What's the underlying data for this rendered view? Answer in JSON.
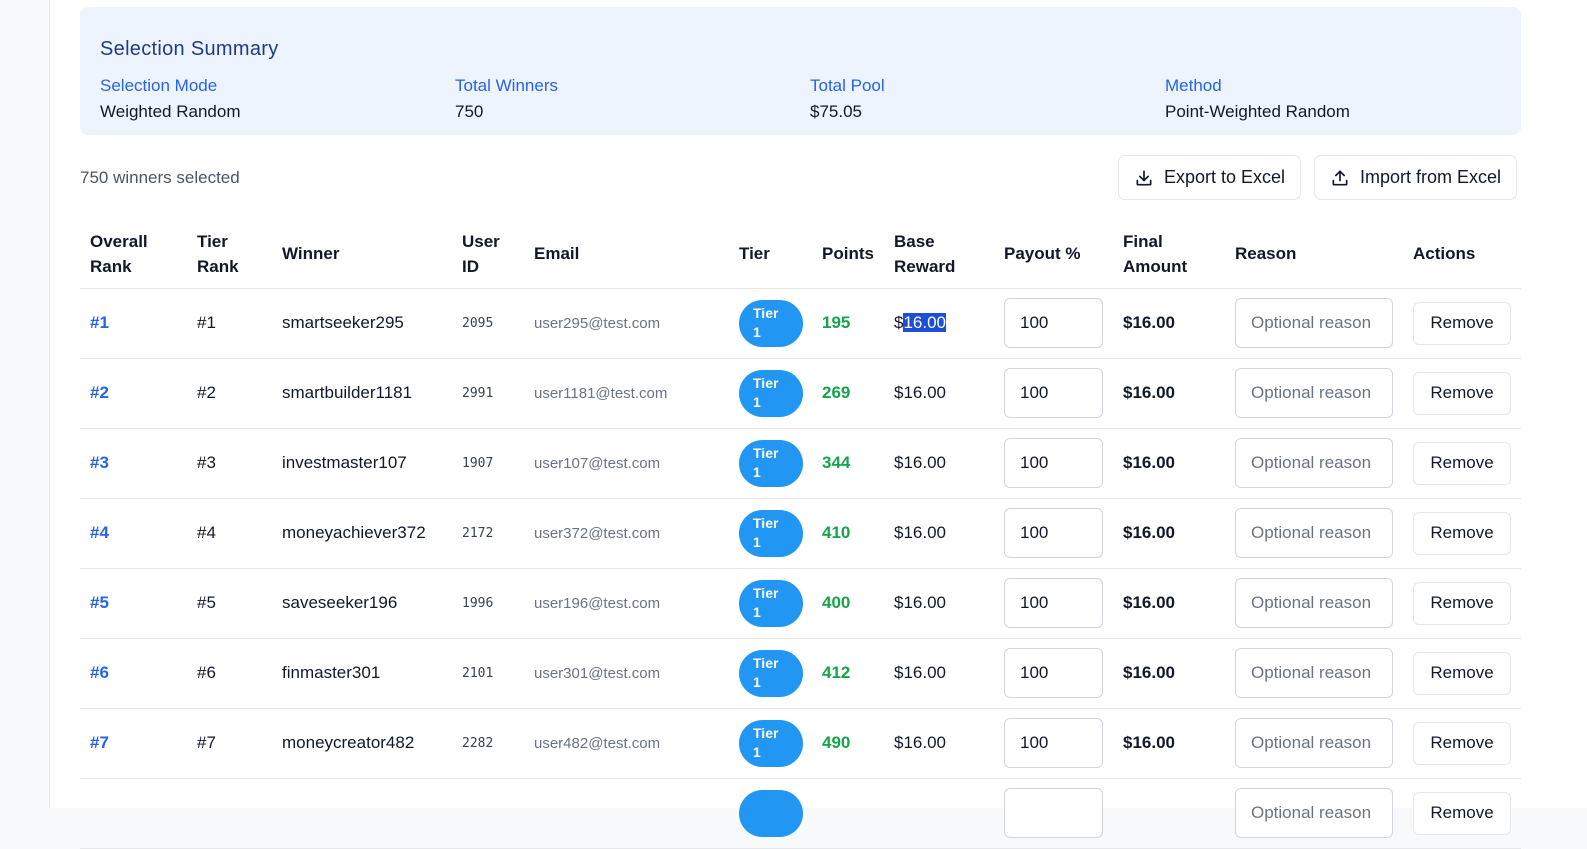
{
  "summary": {
    "title": "Selection Summary",
    "stats": [
      {
        "label": "Selection Mode",
        "value": "Weighted Random"
      },
      {
        "label": "Total Winners",
        "value": "750"
      },
      {
        "label": "Total Pool",
        "value": "$75.05"
      },
      {
        "label": "Method",
        "value": "Point-Weighted Random"
      }
    ]
  },
  "toolbar": {
    "count_text": "750 winners selected",
    "export_label": "Export to Excel",
    "import_label": "Import from Excel"
  },
  "table": {
    "headers": {
      "overall_rank_1": "Overall",
      "overall_rank_2": "Rank",
      "tier_rank_1": "Tier",
      "tier_rank_2": "Rank",
      "winner": "Winner",
      "user_id_1": "User",
      "user_id_2": "ID",
      "email": "Email",
      "tier": "Tier",
      "points": "Points",
      "base_reward_1": "Base",
      "base_reward_2": "Reward",
      "payout": "Payout %",
      "final_amount_1": "Final",
      "final_amount_2": "Amount",
      "reason": "Reason",
      "actions": "Actions"
    },
    "reason_placeholder": "Optional reason",
    "remove_label": "Remove",
    "rows": [
      {
        "overall_rank": "#1",
        "tier_rank": "#1",
        "winner": "smartseeker295",
        "user_id": "2095",
        "email": "user295@test.com",
        "tier_line1": "Tier",
        "tier_line2": "1",
        "points": "195",
        "base_currency": "$",
        "base_amount": "16.00",
        "payout": "100",
        "final_amount": "$16.00"
      },
      {
        "overall_rank": "#2",
        "tier_rank": "#2",
        "winner": "smartbuilder1181",
        "user_id": "2991",
        "email": "user1181@test.com",
        "tier_line1": "Tier",
        "tier_line2": "1",
        "points": "269",
        "base_currency": "$",
        "base_amount": "16.00",
        "payout": "100",
        "final_amount": "$16.00"
      },
      {
        "overall_rank": "#3",
        "tier_rank": "#3",
        "winner": "investmaster107",
        "user_id": "1907",
        "email": "user107@test.com",
        "tier_line1": "Tier",
        "tier_line2": "1",
        "points": "344",
        "base_currency": "$",
        "base_amount": "16.00",
        "payout": "100",
        "final_amount": "$16.00"
      },
      {
        "overall_rank": "#4",
        "tier_rank": "#4",
        "winner": "moneyachiever372",
        "user_id": "2172",
        "email": "user372@test.com",
        "tier_line1": "Tier",
        "tier_line2": "1",
        "points": "410",
        "base_currency": "$",
        "base_amount": "16.00",
        "payout": "100",
        "final_amount": "$16.00"
      },
      {
        "overall_rank": "#5",
        "tier_rank": "#5",
        "winner": "saveseeker196",
        "user_id": "1996",
        "email": "user196@test.com",
        "tier_line1": "Tier",
        "tier_line2": "1",
        "points": "400",
        "base_currency": "$",
        "base_amount": "16.00",
        "payout": "100",
        "final_amount": "$16.00"
      },
      {
        "overall_rank": "#6",
        "tier_rank": "#6",
        "winner": "finmaster301",
        "user_id": "2101",
        "email": "user301@test.com",
        "tier_line1": "Tier",
        "tier_line2": "1",
        "points": "412",
        "base_currency": "$",
        "base_amount": "16.00",
        "payout": "100",
        "final_amount": "$16.00"
      },
      {
        "overall_rank": "#7",
        "tier_rank": "#7",
        "winner": "moneycreator482",
        "user_id": "2282",
        "email": "user482@test.com",
        "tier_line1": "Tier",
        "tier_line2": "1",
        "points": "490",
        "base_currency": "$",
        "base_amount": "16.00",
        "payout": "100",
        "final_amount": "$16.00"
      },
      {
        "overall_rank": "",
        "tier_rank": "",
        "winner": "",
        "user_id": "",
        "email": "",
        "tier_line1": "",
        "tier_line2": "",
        "points": "",
        "base_currency": "",
        "base_amount": "",
        "payout": "",
        "final_amount": ""
      }
    ]
  }
}
